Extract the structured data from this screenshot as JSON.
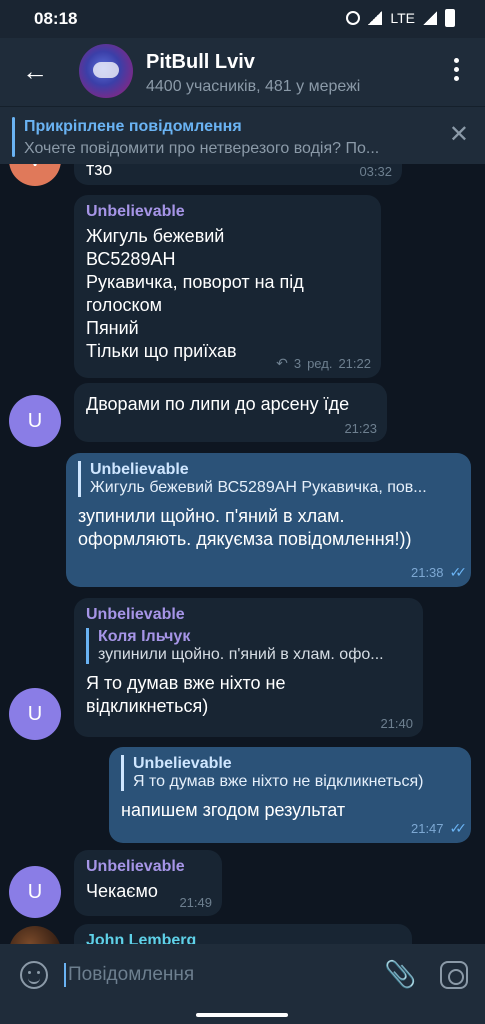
{
  "status": {
    "time": "08:18",
    "network": "LTE"
  },
  "header": {
    "title": "PitBull Lviv",
    "subtitle": "4400 учасників, 481 у мережі"
  },
  "pinned": {
    "title": "Прикріплене повідомлення",
    "text": "Хочете повідомити про нетверезого водія? По..."
  },
  "messages": {
    "m0": {
      "text": "тзо",
      "time": "03:32",
      "avatar_letter": "V"
    },
    "m1": {
      "author": "Unbelievable",
      "lines": [
        "Жигуль бежевий",
        "ВС5289АН",
        "Рукавичка, поворот на під голоском",
        "Пяний",
        "Тільки що приїхав"
      ],
      "replies": "3",
      "edited": "ред.",
      "time": "21:22"
    },
    "m2": {
      "text": "Дворами по липи до арсену їде",
      "time": "21:23",
      "avatar_letter": "U"
    },
    "m3": {
      "quote_author": "Unbelievable",
      "quote_text": "Жигуль бежевий ВС5289АН Рукавичка, пов...",
      "text": "зупинили щойно. п'яний в хлам. оформляють. дякуємза повідомлення!))",
      "time": "21:38"
    },
    "m4": {
      "author": "Unbelievable",
      "quote_author": "Коля Ільчук",
      "quote_text": "зупинили щойно. п'яний в хлам. офо...",
      "text": "Я то думав вже ніхто не відкликнеться)",
      "time": "21:40",
      "avatar_letter": "U"
    },
    "m5": {
      "quote_author": "Unbelievable",
      "quote_text": "Я то думав вже ніхто не відкликнеться)",
      "text": "напишем згодом результат",
      "time": "21:47"
    },
    "m6": {
      "author": "Unbelievable",
      "text": "Чекаємо",
      "time": "21:49",
      "avatar_letter": "U"
    },
    "m7": {
      "author": "John Lemberg"
    }
  },
  "composer": {
    "placeholder": "Повідомлення"
  },
  "colors": {
    "background": "#0e1621",
    "incoming": "#182533",
    "outgoing": "#2b5278",
    "accent": "#6ab3f3",
    "author": "#a695e7"
  }
}
